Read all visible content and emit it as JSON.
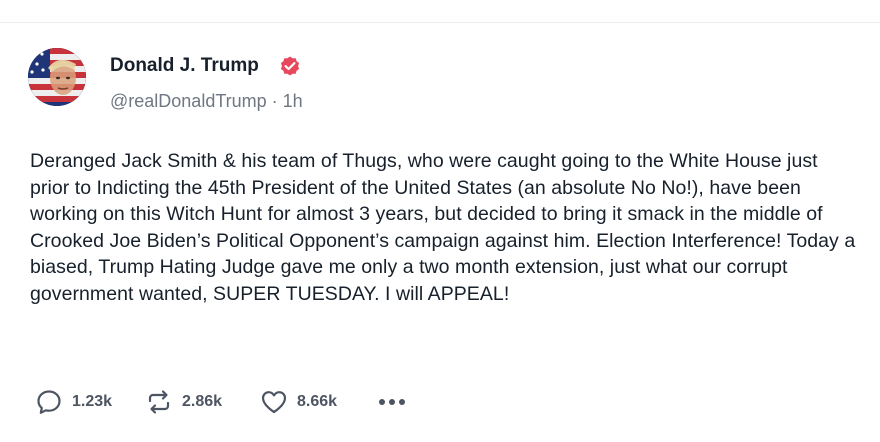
{
  "post": {
    "author_name": "Donald J. Trump",
    "handle": "@realDonaldTrump",
    "separator": "·",
    "timestamp": "1h",
    "body": "Deranged Jack Smith & his team of Thugs, who were caught going to the White House just prior to Indicting the 45th President of the United States (an absolute No No!), have been working on this Witch Hunt for almost 3 years, but decided to bring it smack in the middle of Crooked Joe Biden’s Political Opponent’s campaign against him. Election Interference! Today a biased, Trump Hating Judge gave me only a two month extension, just what our corrupt government wanted, SUPER TUESDAY. I will APPEAL!",
    "verified": true
  },
  "actions": {
    "replies": "1.23k",
    "restruths": "2.86k",
    "likes": "8.66k"
  },
  "icons": {
    "reply": "speech-bubble-icon",
    "restruth": "repost-arrows-icon",
    "like": "heart-icon",
    "more": "ellipsis-icon",
    "verified": "verified-badge-icon"
  },
  "colors": {
    "text": "#17202b",
    "muted": "#707782",
    "verified_badge": "#e8485d",
    "action_icon": "#4d5562"
  }
}
